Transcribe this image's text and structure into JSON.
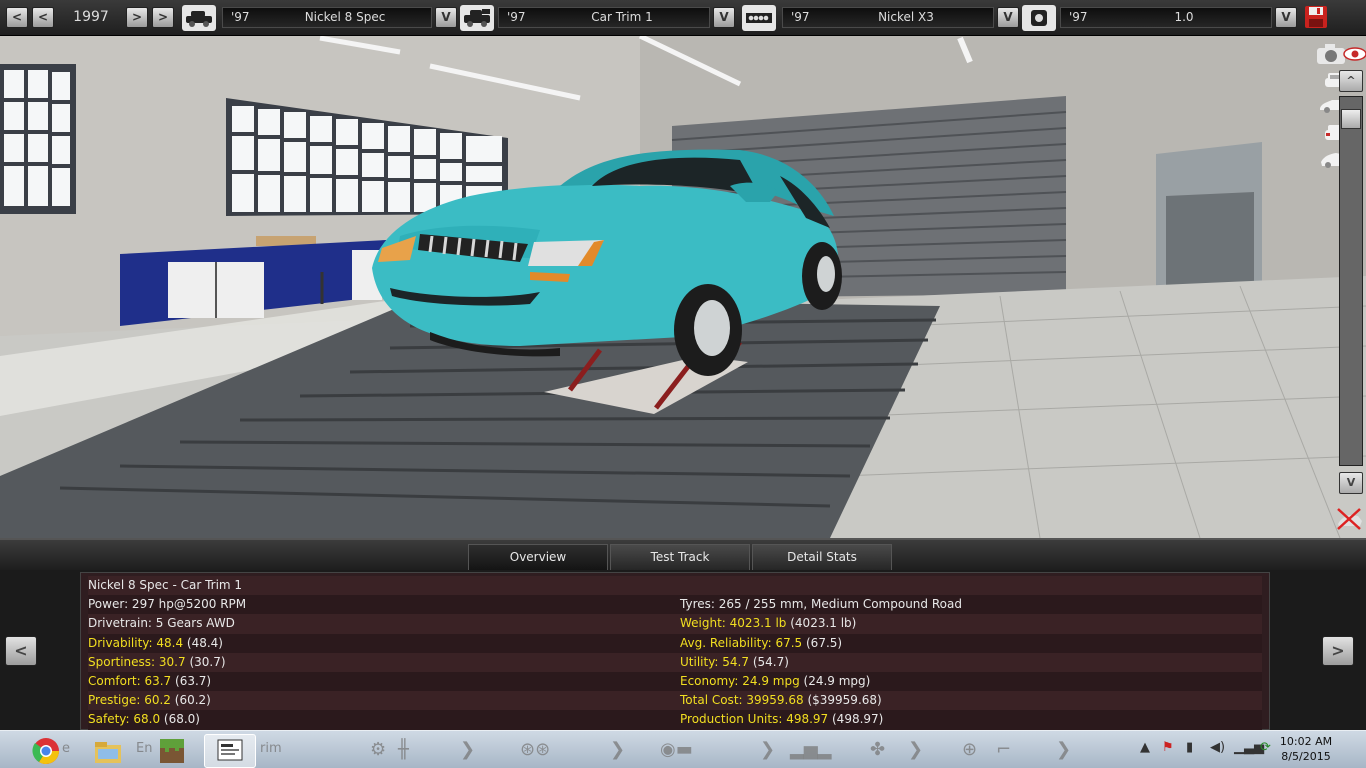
{
  "topbar": {
    "prev_label": "<",
    "prev_label_2": "<",
    "year": "1997",
    "next_label": ">",
    "next_label_2": ">",
    "icons": [
      "car-side-icon",
      "car-trim-icon",
      "engine-icon",
      "engine-variant-icon"
    ],
    "dropdown_label": "V",
    "slots": [
      {
        "year": "'97",
        "name": "Nickel  8 Spec"
      },
      {
        "year": "'97",
        "name": "Car Trim 1"
      },
      {
        "year": "'97",
        "name": "Nickel X3"
      },
      {
        "year": "'97",
        "name": "1.0"
      }
    ],
    "save_icon": "floppy-disk-icon"
  },
  "scene": {
    "car_color": "#3bbcc4",
    "side_icons": [
      "camera-icon",
      "eye-icon",
      "car-front-icon",
      "car-side-icon",
      "car-rear-icon",
      "car-angle-icon"
    ],
    "scroll_up_label": "^",
    "scroll_down_label": "V",
    "hide_icon": "crossed-out-icon"
  },
  "tabs": [
    {
      "label": "Overview",
      "active": true
    },
    {
      "label": "Test Track",
      "active": false
    },
    {
      "label": "Detail Stats",
      "active": false
    }
  ],
  "panel": {
    "prev_label": "<",
    "next_label": ">",
    "rows": [
      {
        "left": {
          "label": "Nickel  8 Spec - Car Trim 1",
          "value": "",
          "highlight": false
        },
        "right": null
      },
      {
        "left": {
          "label": "Power: 297 hp@5200 RPM",
          "value": "",
          "highlight": false
        },
        "right": {
          "label": "Tyres: 265 / 255 mm, Medium Compound Road",
          "value": "",
          "highlight": false
        }
      },
      {
        "left": {
          "label": "Drivetrain: 5 Gears AWD",
          "value": "",
          "highlight": false
        },
        "right": {
          "label": "Weight: 4023.1 lb",
          "value": " (4023.1 lb)",
          "highlight": true
        }
      },
      {
        "left": {
          "label": "Drivability: 48.4",
          "value": " (48.4)",
          "highlight": true
        },
        "right": {
          "label": "Avg. Reliability: 67.5",
          "value": " (67.5)",
          "highlight": true
        }
      },
      {
        "left": {
          "label": "Sportiness: 30.7",
          "value": " (30.7)",
          "highlight": true
        },
        "right": {
          "label": "Utility: 54.7",
          "value": " (54.7)",
          "highlight": true
        }
      },
      {
        "left": {
          "label": "Comfort: 63.7",
          "value": " (63.7)",
          "highlight": true
        },
        "right": {
          "label": "Economy: 24.9 mpg",
          "value": " (24.9 mpg)",
          "highlight": true
        }
      },
      {
        "left": {
          "label": "Prestige: 60.2",
          "value": " (60.2)",
          "highlight": true
        },
        "right": {
          "label": "Total Cost: 39959.68",
          "value": " ($39959.68)",
          "highlight": true
        }
      },
      {
        "left": {
          "label": "Safety: 68.0",
          "value": " (68.0)",
          "highlight": true
        },
        "right": {
          "label": "Production Units: 498.97",
          "value": " (498.97)",
          "highlight": true
        }
      }
    ]
  },
  "taskbar": {
    "apps": [
      {
        "name": "chrome-icon"
      },
      {
        "name": "file-explorer-icon"
      },
      {
        "name": "minecraft-icon"
      },
      {
        "name": "automation-game-icon"
      }
    ],
    "ghost_text": "e",
    "ghost_text_2": "En",
    "ghost_text_3": "rim",
    "ghost_icons": [
      "wheel-icon",
      "gearbox-icon",
      "chevron-right-icon",
      "brake-icon",
      "chevron-right-icon",
      "tyre-icon",
      "chevron-right-icon",
      "car-body-icon",
      "fan-icon",
      "chevron-right-icon",
      "steering-wheel-icon",
      "seat-icon",
      "chevron-right-icon"
    ],
    "tray_icons": [
      "show-hidden-icon",
      "flag-icon",
      "battery-icon",
      "volume-icon",
      "signal-icon",
      "update-icon"
    ],
    "time": "10:02 AM",
    "date": "8/5/2015"
  }
}
